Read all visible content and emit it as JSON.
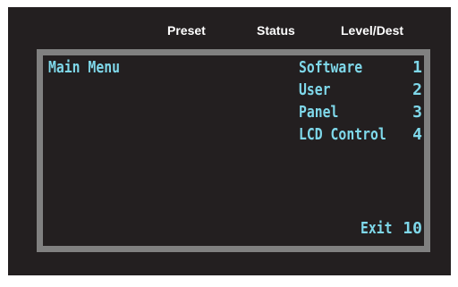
{
  "header": {
    "preset_label": "Preset",
    "status_label": "Status",
    "level_label": "Level/Dest"
  },
  "lcd": {
    "title": "Main Menu",
    "items": [
      {
        "label": "Software",
        "number": "1"
      },
      {
        "label": "User",
        "number": "2"
      },
      {
        "label": "Panel",
        "number": "3"
      },
      {
        "label": "LCD Control",
        "number": "4"
      }
    ],
    "exit": {
      "label": "Exit",
      "number": "10"
    }
  },
  "colors": {
    "device_background": "#231f20",
    "bezel": "#808080",
    "lcd_text": "#7fd8ea",
    "header_text": "#ffffff"
  }
}
